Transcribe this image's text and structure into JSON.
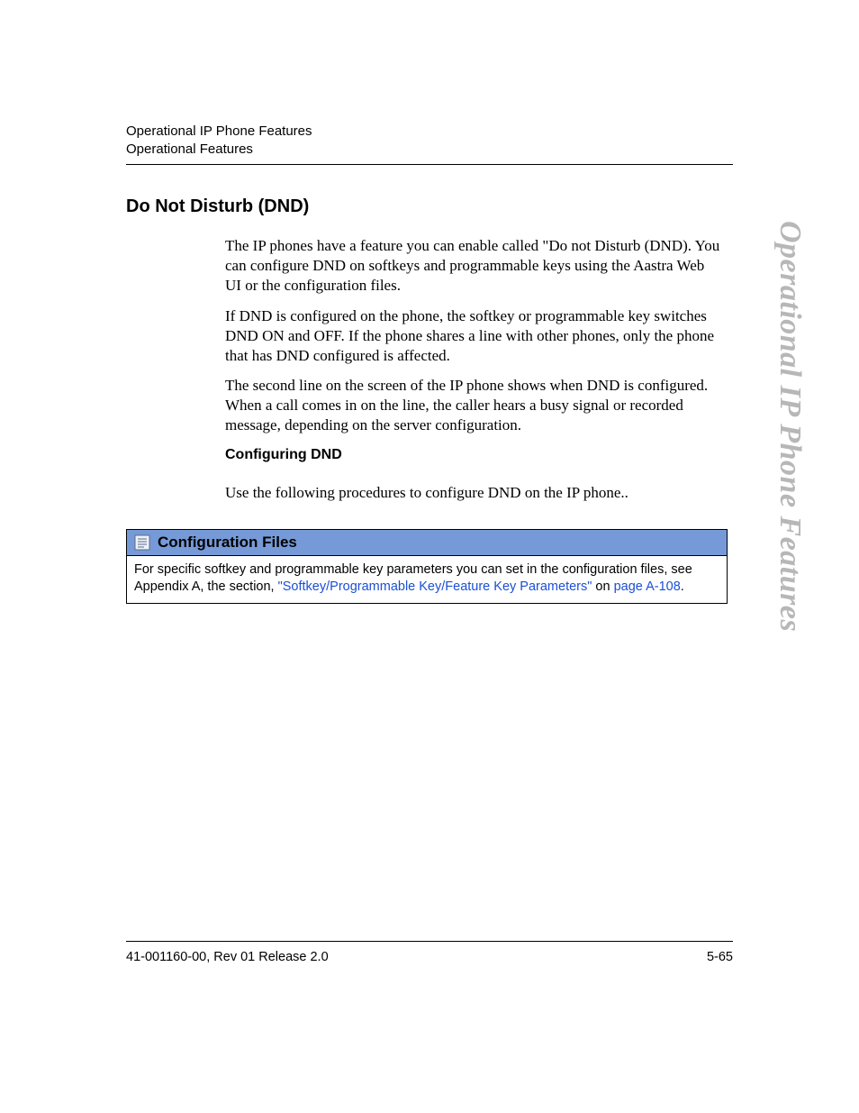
{
  "header": {
    "line1": "Operational IP Phone Features",
    "line2": "Operational Features"
  },
  "side_tab": "Operational IP Phone Features",
  "section": {
    "heading": "Do Not Disturb (DND)",
    "para1": "The IP phones have a feature you can enable called \"Do not Disturb (DND). You can configure DND on softkeys and programmable keys using the Aastra Web UI or the configuration files.",
    "para2": "If DND is configured on the phone, the softkey or programmable key switches DND ON and OFF. If the phone shares a line with other phones, only the phone that has DND configured is affected.",
    "para3": "The second line on the screen of the IP phone shows when DND is configured. When a call comes in on the line, the caller hears a busy signal or recorded message, depending on the server configuration.",
    "subheading": "Configuring DND",
    "para4": "Use the following procedures to configure DND on the IP phone.."
  },
  "config_box": {
    "title": "Configuration Files",
    "body_pre": "For specific softkey and programmable key parameters you can set in the configuration files, see Appendix A, the section, ",
    "link1": "\"Softkey/Programmable Key/Feature Key Parameters\"",
    "body_mid": " on ",
    "link2": "page A-108",
    "body_post": "."
  },
  "footer": {
    "left": "41-001160-00, Rev 01  Release 2.0",
    "right": "5-65"
  }
}
